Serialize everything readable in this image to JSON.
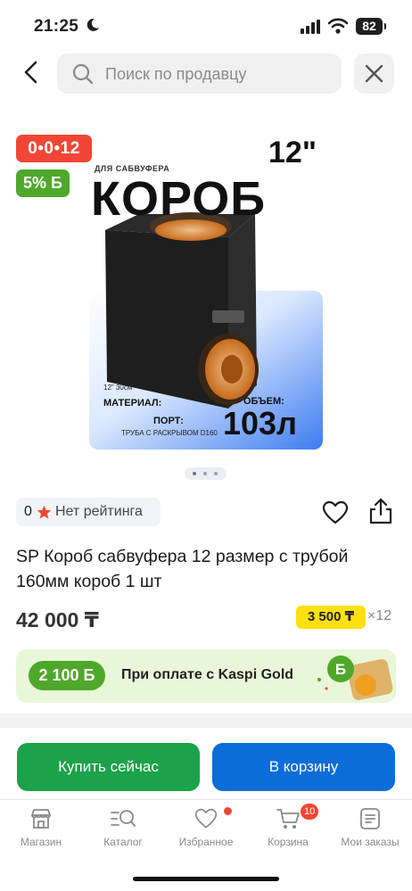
{
  "status_bar": {
    "time": "21:25",
    "battery": "82"
  },
  "header": {
    "search_placeholder": "Поиск по продавцу"
  },
  "badges": {
    "installment": "0•0•12",
    "bonus": "5% Б"
  },
  "product_image": {
    "top_label": "ДЛЯ САБВУФЕРА",
    "size": "12\"",
    "word": "КОРОБ",
    "dims": "12\" 30см",
    "material": "МАТЕРИАЛ:",
    "port_label": "ПОРТ:",
    "port_value": "ТРУБА С РАСКРЫВОМ D160",
    "volume_label": "ОБЪЕМ:",
    "volume_value": "103л"
  },
  "gallery": {
    "current": 1,
    "total": 3
  },
  "rating": {
    "count": "0",
    "text": "Нет рейтинга"
  },
  "product": {
    "title": "SP Короб сабвуфера 12 размер с трубой 160мм короб 1 шт",
    "price": "42 000 ₸",
    "installment_price": "3 500 ₸",
    "installment_months": "×12"
  },
  "kaspi_gold": {
    "bonus": "2 100 Б",
    "text": "При оплате с Kaspi Gold"
  },
  "actions": {
    "buy_now": "Купить сейчас",
    "add_to_cart": "В корзину"
  },
  "nav": {
    "items": [
      {
        "label": "Магазин",
        "icon": "shop-icon"
      },
      {
        "label": "Каталог",
        "icon": "catalog-icon"
      },
      {
        "label": "Избранное",
        "icon": "heart-icon"
      },
      {
        "label": "Корзина",
        "icon": "cart-icon"
      },
      {
        "label": "Мои заказы",
        "icon": "orders-icon"
      }
    ],
    "cart_count": "10"
  },
  "colors": {
    "red": "#f14635",
    "green": "#4fa82b",
    "buy_green": "#1ba24a",
    "cart_blue": "#0b6dd8",
    "installment_yellow": "#ffe00e"
  }
}
